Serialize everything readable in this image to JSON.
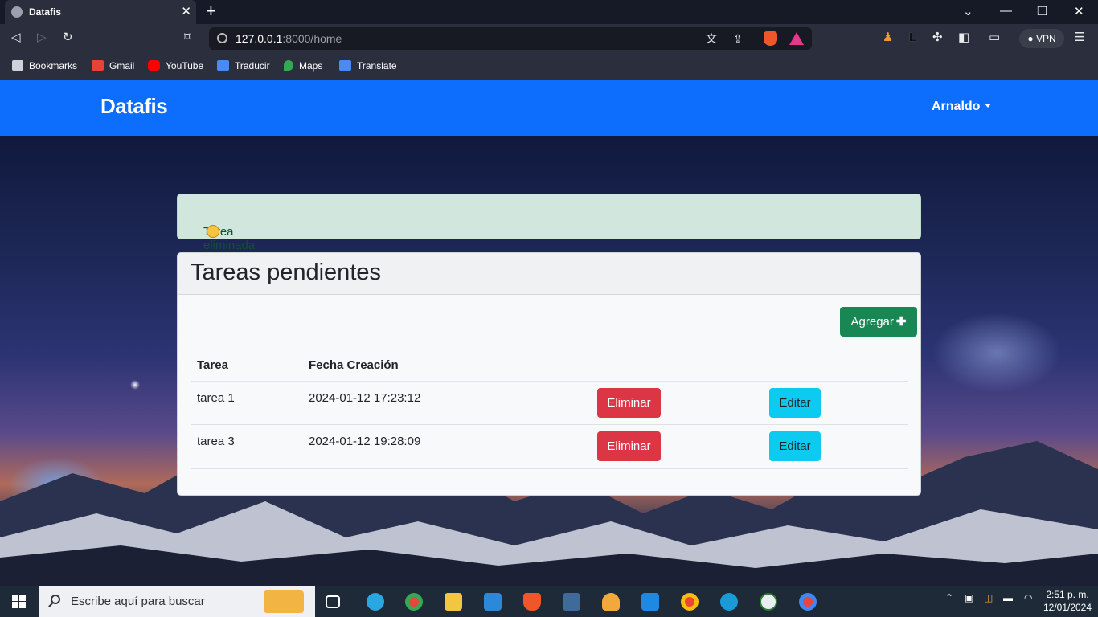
{
  "browser": {
    "tab_title": "Datafis",
    "url_host": "127.0.0.1",
    "url_rest": ":8000/home",
    "vpn_label": "VPN",
    "bookmarks": [
      {
        "label": "Bookmarks",
        "icon": "folder-icon"
      },
      {
        "label": "Gmail",
        "icon": "gmail-icon"
      },
      {
        "label": "YouTube",
        "icon": "youtube-icon"
      },
      {
        "label": "Traducir",
        "icon": "translate-icon"
      },
      {
        "label": "Maps",
        "icon": "maps-icon"
      },
      {
        "label": "Translate",
        "icon": "translate-icon"
      }
    ]
  },
  "navbar": {
    "brand": "Datafis",
    "user": "Arnaldo",
    "color": "#0d6efd"
  },
  "alert": {
    "message": "Tarea eliminada correctamente",
    "icon": "smiley-icon"
  },
  "card": {
    "title": "Tareas pendientes",
    "add_button": "Agregar",
    "columns": [
      "Tarea",
      "Fecha Creación"
    ],
    "rows": [
      {
        "task": "tarea 1",
        "created": "2024-01-12 17:23:12",
        "delete_label": "Eliminar",
        "edit_label": "Editar"
      },
      {
        "task": "tarea 3",
        "created": "2024-01-12 19:28:09",
        "delete_label": "Eliminar",
        "edit_label": "Editar"
      }
    ]
  },
  "taskbar": {
    "search_placeholder": "Escribe aquí para buscar",
    "time": "2:51 p. m.",
    "date": "12/01/2024"
  }
}
